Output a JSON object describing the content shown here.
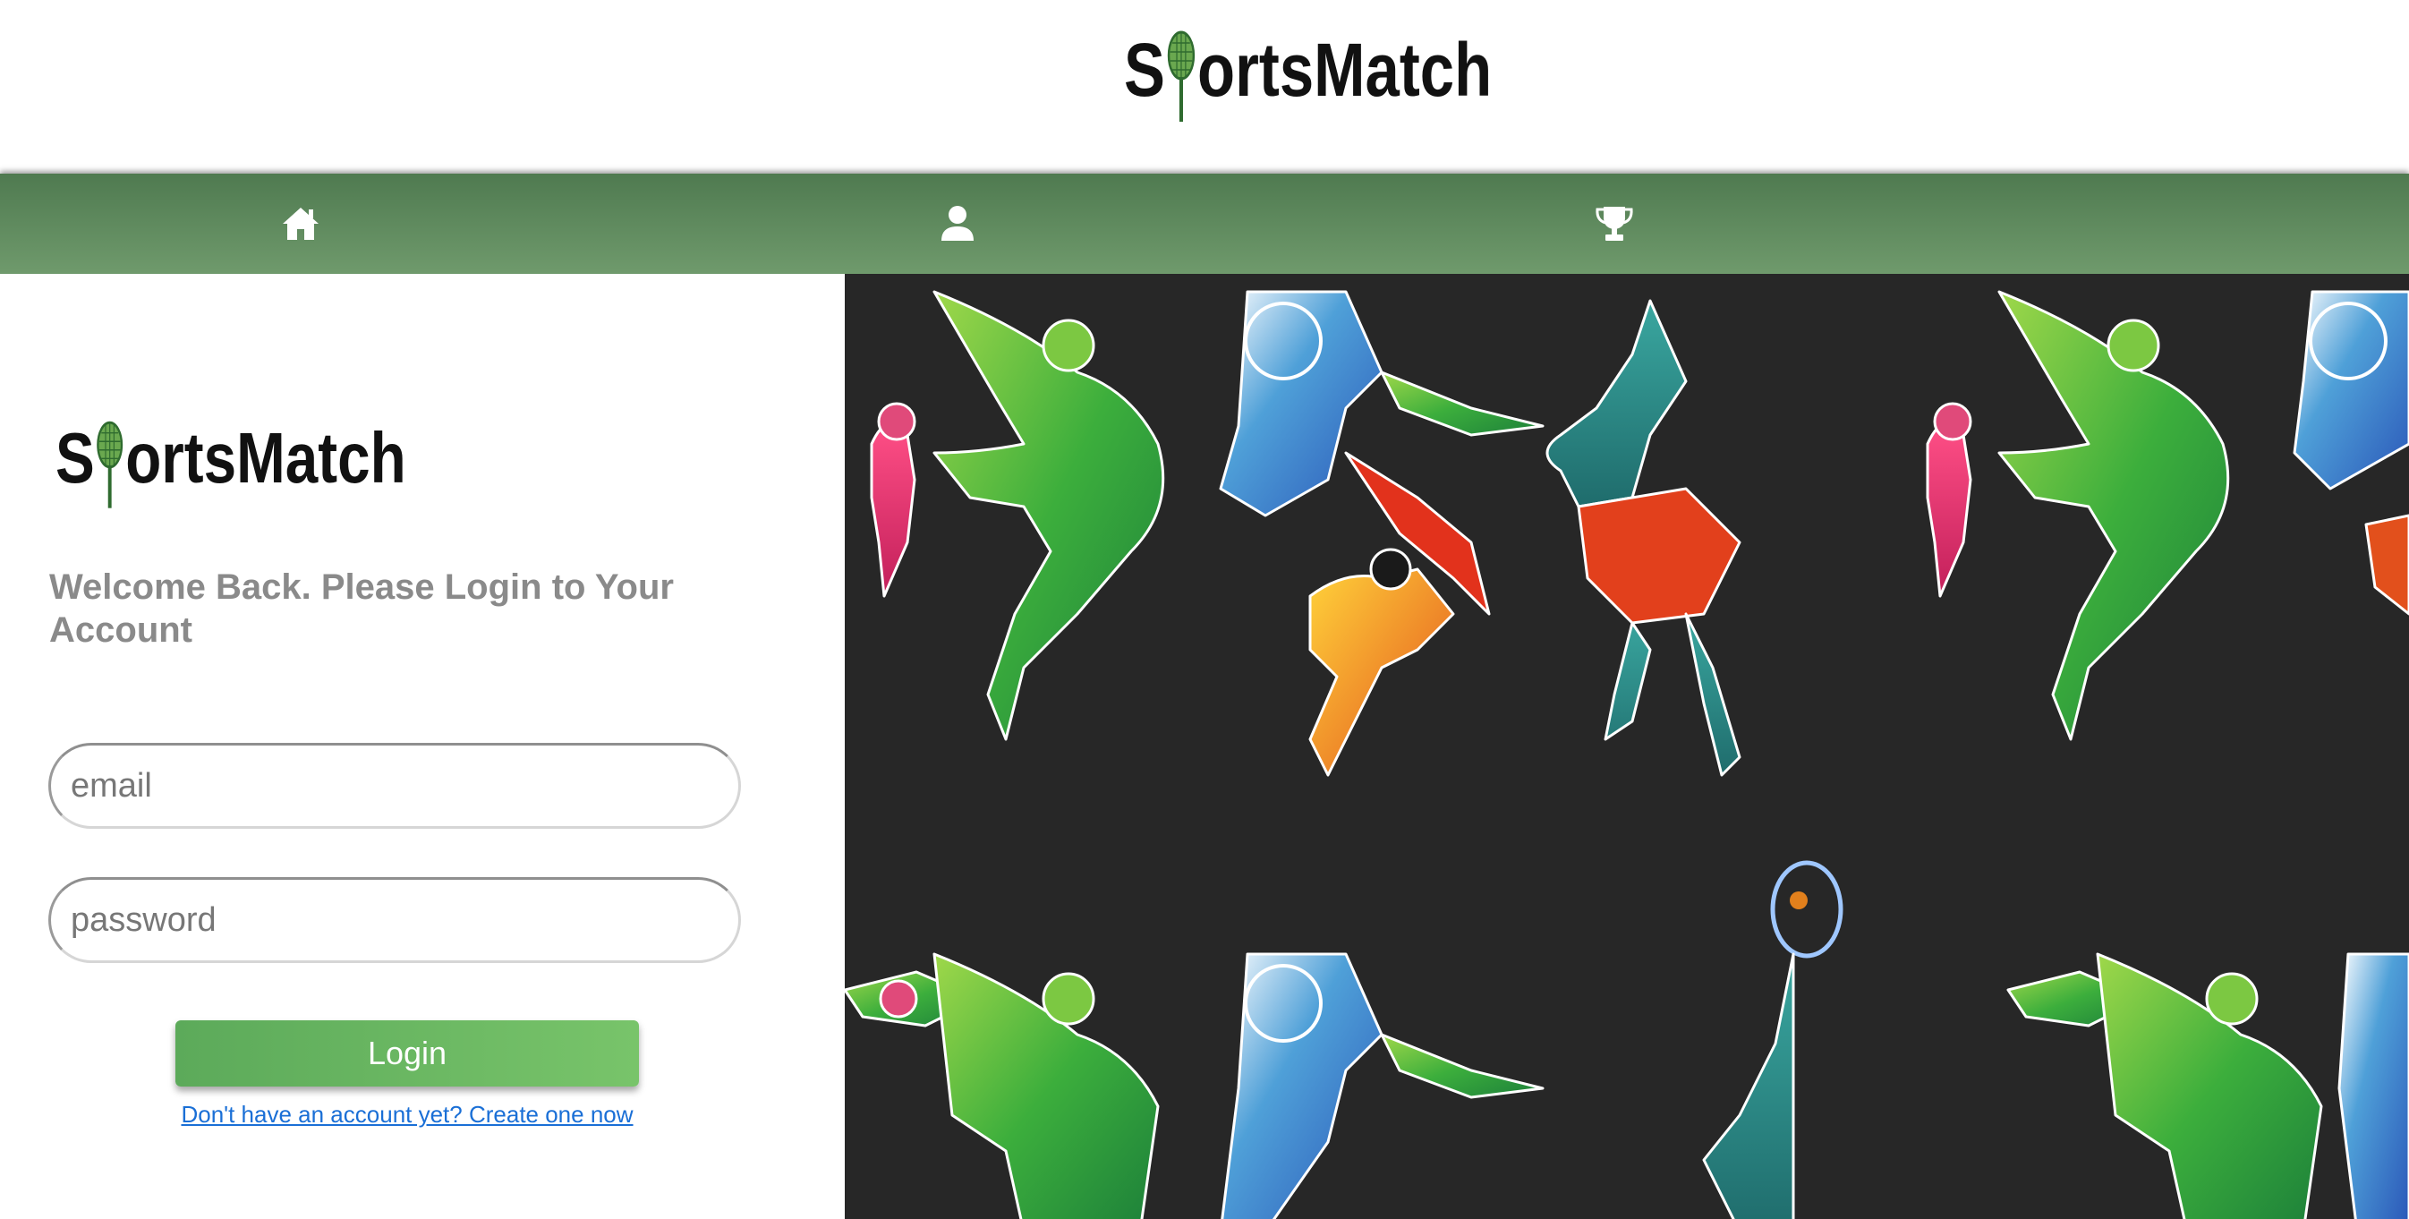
{
  "app": {
    "brand_prefix": "S",
    "brand_suffix": "ortsMatch"
  },
  "nav": {
    "items": [
      {
        "icon": "home-icon"
      },
      {
        "icon": "user-icon"
      },
      {
        "icon": "trophy-icon"
      }
    ]
  },
  "login": {
    "welcome": "Welcome Back. Please Login to Your Account",
    "email_placeholder": "email",
    "password_placeholder": "password",
    "login_label": "Login",
    "signup_link": "Don't have an account yet? Create one now"
  },
  "colors": {
    "nav_top": "#4f7a50",
    "nav_bottom": "#6f9a6c",
    "button": "#66b55f",
    "link": "#1a6fd6",
    "welcome_text": "#8a8a8a",
    "artwork_bg": "#272727"
  }
}
